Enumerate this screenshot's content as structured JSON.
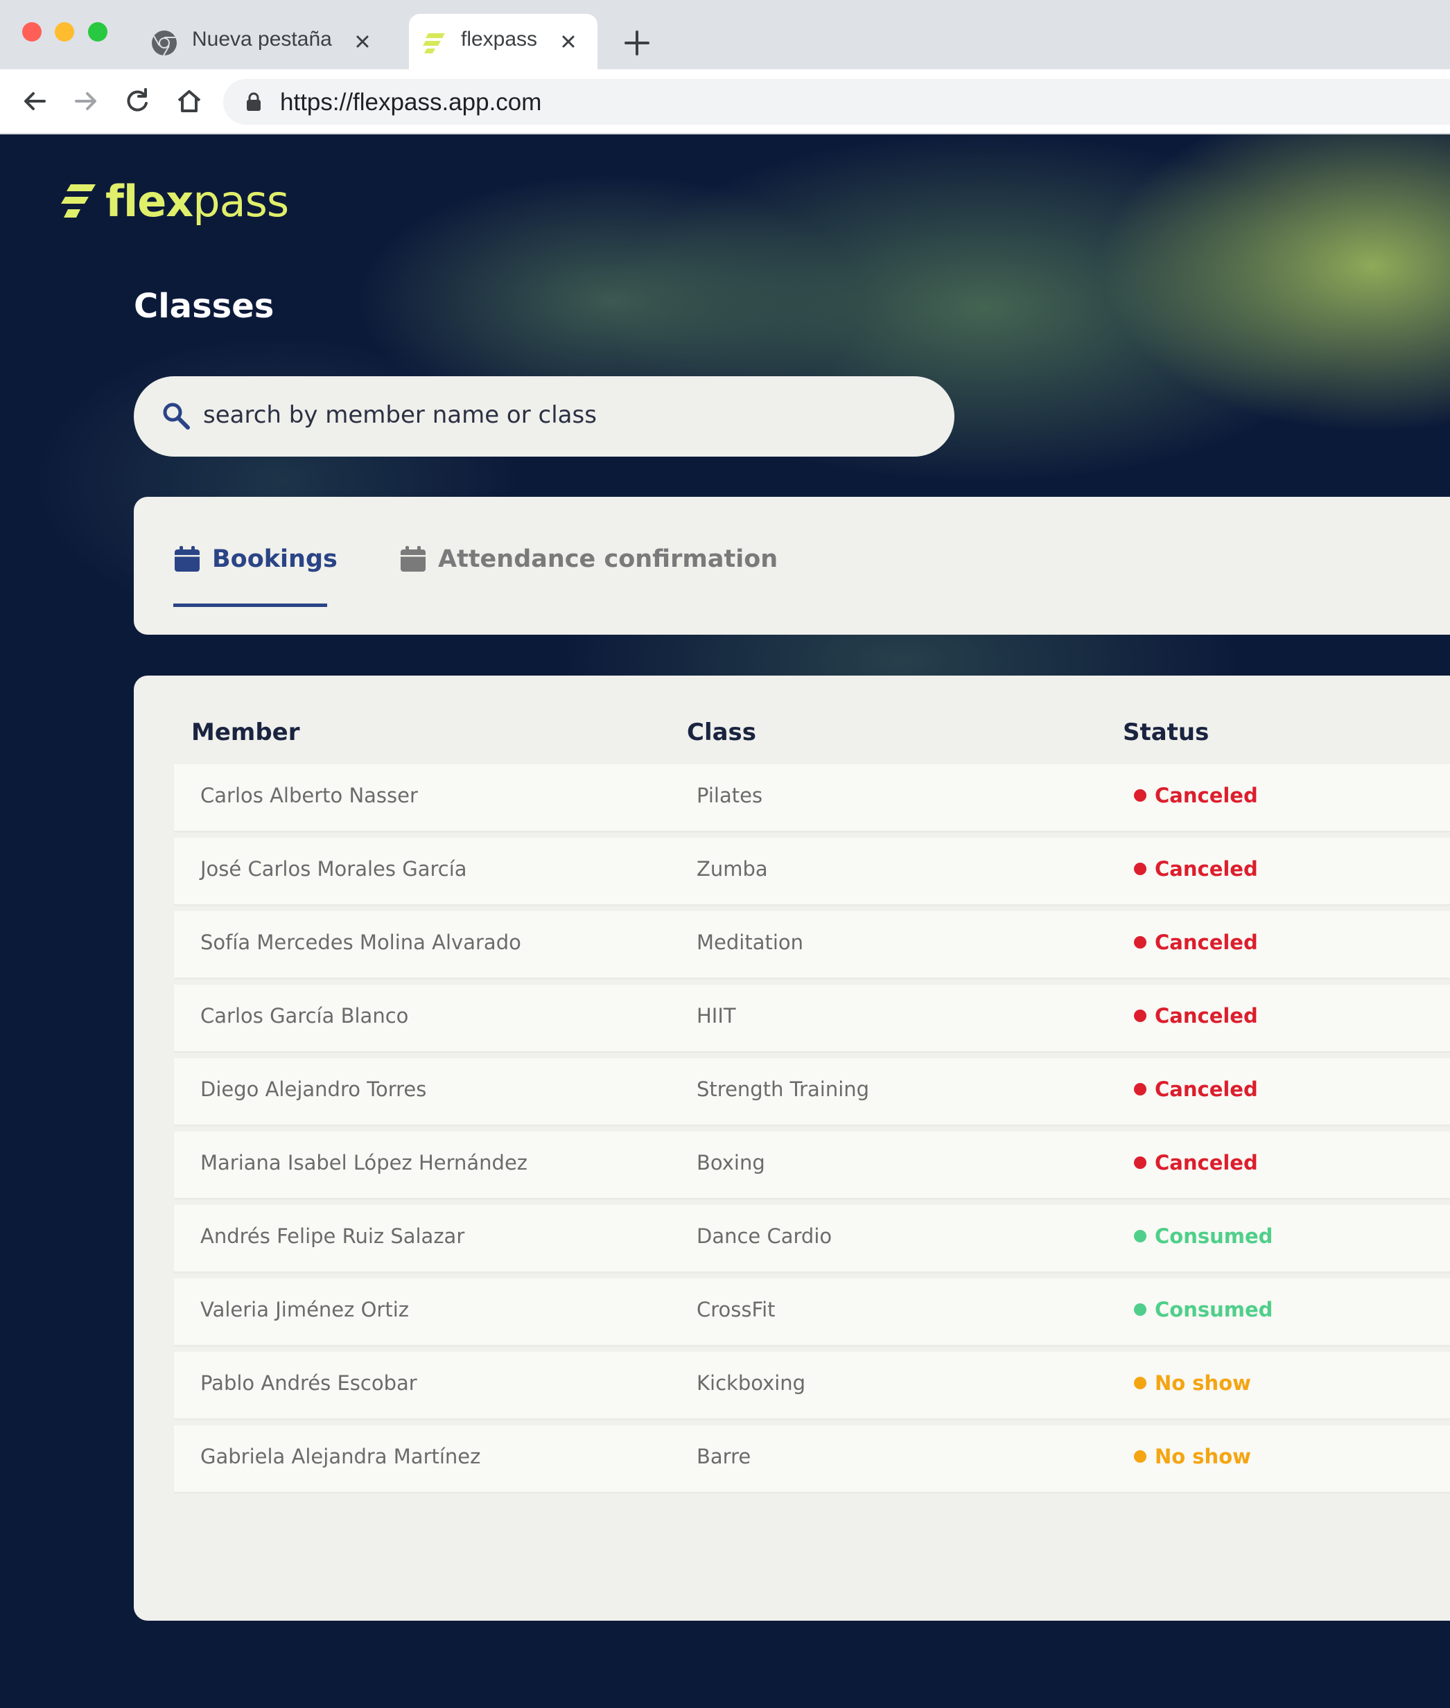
{
  "browser": {
    "tabs": [
      {
        "title": "Nueva pestaña",
        "active": false,
        "icon": "chrome-icon"
      },
      {
        "title": "flexpass",
        "active": true,
        "icon": "flexpass-favicon"
      }
    ],
    "url": "https://flexpass.app.com"
  },
  "app": {
    "logo": {
      "bold": "flex",
      "regular": "pass"
    },
    "page_title": "Classes",
    "search": {
      "placeholder": "search by member name or class"
    },
    "tabs": [
      {
        "label": "Bookings",
        "active": true,
        "icon": "calendar-icon"
      },
      {
        "label": "Attendance confirmation",
        "active": false,
        "icon": "calendar-icon"
      }
    ],
    "table": {
      "headers": {
        "member": "Member",
        "class": "Class",
        "status": "Status"
      },
      "rows": [
        {
          "member": "Carlos Alberto Nasser",
          "class": "Pilates",
          "status": "Canceled",
          "color": "#dc1e2d"
        },
        {
          "member": "José Carlos Morales García",
          "class": "Zumba",
          "status": "Canceled",
          "color": "#dc1e2d"
        },
        {
          "member": "Sofía Mercedes Molina Alvarado",
          "class": "Meditation",
          "status": "Canceled",
          "color": "#dc1e2d"
        },
        {
          "member": "Carlos García Blanco",
          "class": "HIIT",
          "status": "Canceled",
          "color": "#dc1e2d"
        },
        {
          "member": "Diego Alejandro Torres",
          "class": "Strength Training",
          "status": "Canceled",
          "color": "#dc1e2d"
        },
        {
          "member": "Mariana Isabel López Hernández",
          "class": "Boxing",
          "status": "Canceled",
          "color": "#dc1e2d"
        },
        {
          "member": "Andrés Felipe Ruiz Salazar",
          "class": "Dance Cardio",
          "status": "Consumed",
          "color": "#4fcf8a"
        },
        {
          "member": "Valeria Jiménez Ortiz",
          "class": "CrossFit",
          "status": "Consumed",
          "color": "#4fcf8a"
        },
        {
          "member": "Pablo Andrés Escobar",
          "class": "Kickboxing",
          "status": "No show",
          "color": "#f4a512"
        },
        {
          "member": "Gabriela Alejandra Martínez",
          "class": "Barre",
          "status": "No show",
          "color": "#f4a512"
        }
      ]
    }
  },
  "colors": {
    "brand_accent": "#e0ef6a",
    "primary": "#2a4486",
    "background": "#0c1a3a",
    "canceled": "#dc1e2d",
    "consumed": "#4fcf8a",
    "no_show": "#f4a512"
  }
}
